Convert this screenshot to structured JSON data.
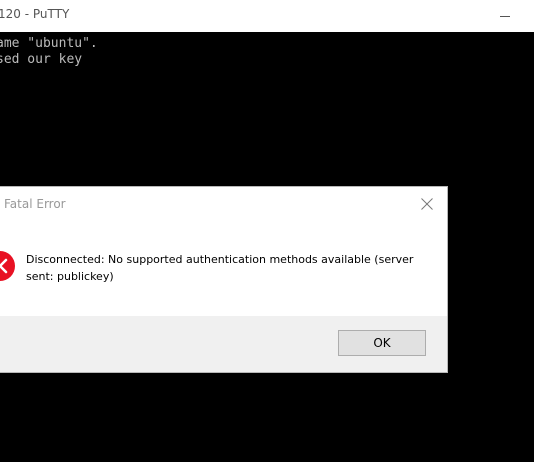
{
  "window": {
    "title": "120 - PuTTY"
  },
  "terminal": {
    "lines": [
      "ame \"ubuntu\".",
      "sed our key"
    ]
  },
  "dialog": {
    "title": "Fatal Error",
    "message": "Disconnected: No supported authentication methods available (server sent: publickey)",
    "ok_label": "OK",
    "icon": "error-icon"
  },
  "colors": {
    "terminal_bg": "#000000",
    "terminal_text": "#bbbbbb",
    "error_red": "#e81123",
    "button_bar": "#f0f0f0"
  }
}
